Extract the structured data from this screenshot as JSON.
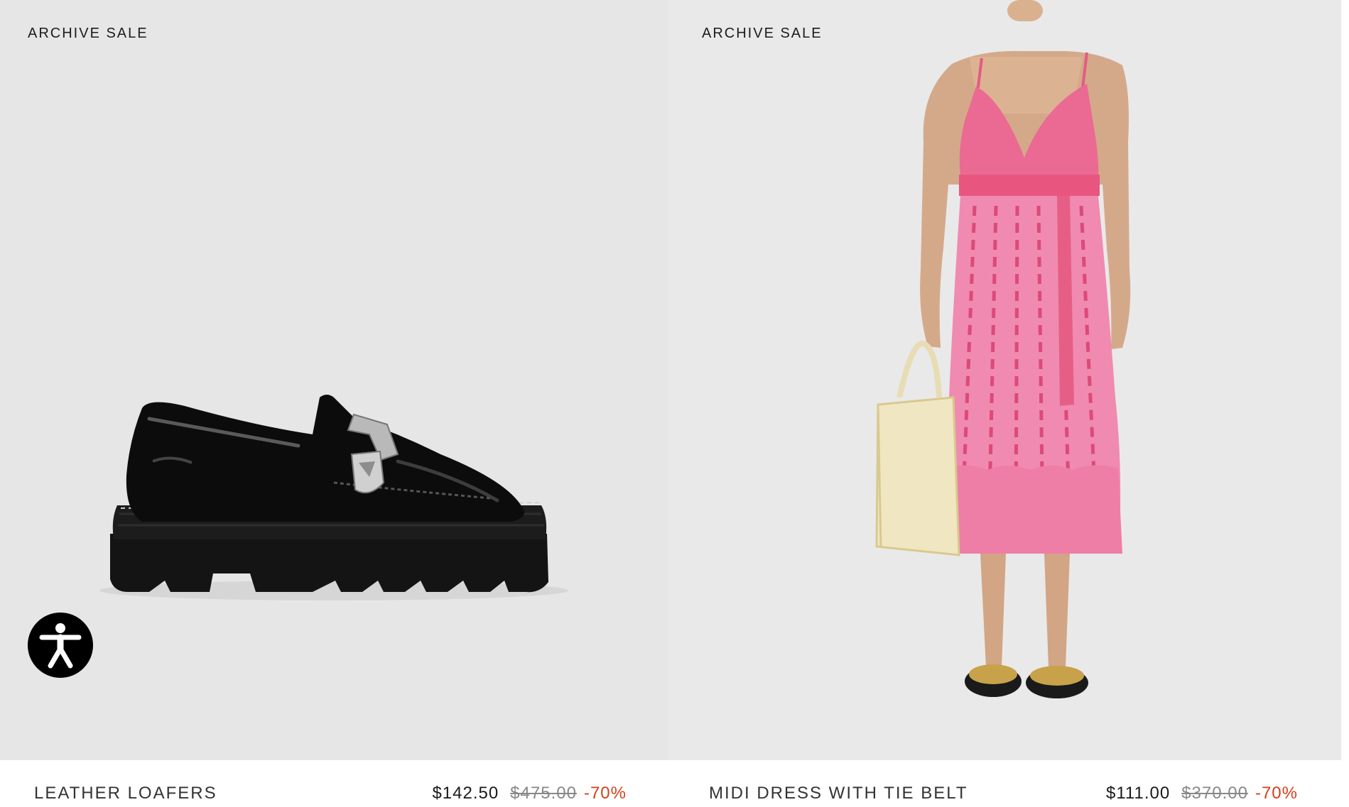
{
  "products": [
    {
      "badge": "ARCHIVE SALE",
      "name": "LEATHER LOAFERS",
      "price": "$142.50",
      "original_price": "$475.00",
      "discount": "-70%",
      "image_alt": "black patent leather loafer with silver buckle"
    },
    {
      "badge": "ARCHIVE SALE",
      "name": "MIDI DRESS WITH TIE BELT",
      "price": "$111.00",
      "original_price": "$370.00",
      "discount": "-70%",
      "image_alt": "model in pink printed midi dress holding straw tote"
    }
  ],
  "accessibility_button": {
    "icon": "accessibility-icon",
    "label": "Accessibility"
  },
  "colors": {
    "discount": "#d4401a",
    "media_bg": "#e6e6e6",
    "accessibility_bg": "#000000"
  }
}
